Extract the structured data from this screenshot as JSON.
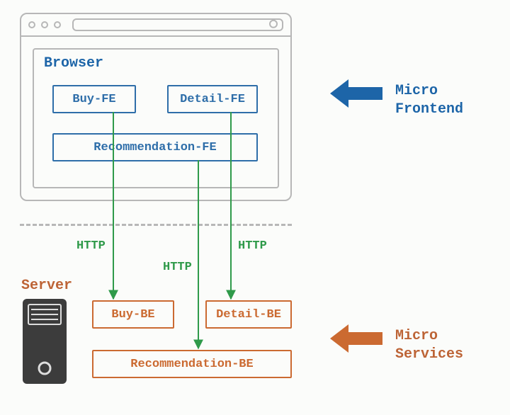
{
  "browser": {
    "title": "Browser",
    "fe": {
      "buy": "Buy-FE",
      "detail": "Detail-FE",
      "recommendation": "Recommendation-FE"
    }
  },
  "server": {
    "title": "Server",
    "be": {
      "buy": "Buy-BE",
      "detail": "Detail-BE",
      "recommendation": "Recommendation-BE"
    }
  },
  "arrows": {
    "http1": "HTTP",
    "http2": "HTTP",
    "http3": "HTTP"
  },
  "side": {
    "frontend_l1": "Micro",
    "frontend_l2": "Frontend",
    "services_l1": "Micro",
    "services_l2": "Services"
  },
  "colors": {
    "blue": "#1d65a8",
    "blue_box": "#2e6ea9",
    "orange": "#cb6a31",
    "orange_text": "#bd6436",
    "green": "#2f9a4a",
    "gray": "#b7b7b7",
    "dark": "#3c3c3c"
  }
}
